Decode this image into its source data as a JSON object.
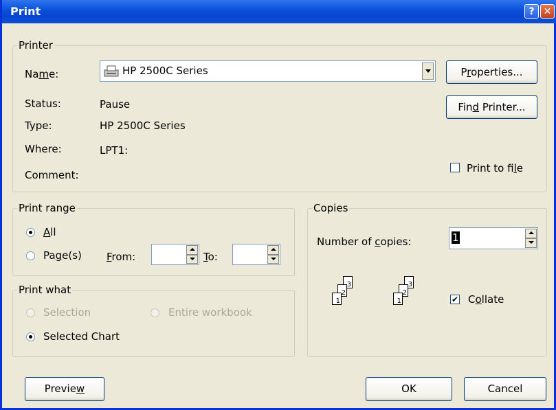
{
  "window": {
    "title": "Print"
  },
  "printer_group": {
    "legend": "Printer",
    "name_label": "Name:",
    "name_value": "HP 2500C Series",
    "status_label": "Status:",
    "status_value": "Pause",
    "type_label": "Type:",
    "type_value": "HP 2500C Series",
    "where_label": "Where:",
    "where_value": "LPT1:",
    "comment_label": "Comment:",
    "comment_value": "",
    "properties_button": "Properties...",
    "find_printer_button": "Find Printer...",
    "print_to_file_label": "Print to file",
    "print_to_file_checked": false
  },
  "print_range": {
    "legend": "Print range",
    "all_label": "All",
    "pages_label": "Page(s)",
    "from_label": "From:",
    "to_label": "To:",
    "from_value": "",
    "to_value": "",
    "selected": "All"
  },
  "print_what": {
    "legend": "Print what",
    "selection_label": "Selection",
    "entire_workbook_label": "Entire workbook",
    "selected_chart_label": "Selected Chart",
    "selected": "Selected Chart"
  },
  "copies": {
    "legend": "Copies",
    "number_label": "Number of copies:",
    "number_value": "1",
    "collate_label": "Collate",
    "collate_checked": true,
    "page_numbers": [
      "1",
      "2",
      "3"
    ]
  },
  "footer": {
    "preview_button": "Preview",
    "ok_button": "OK",
    "cancel_button": "Cancel"
  }
}
